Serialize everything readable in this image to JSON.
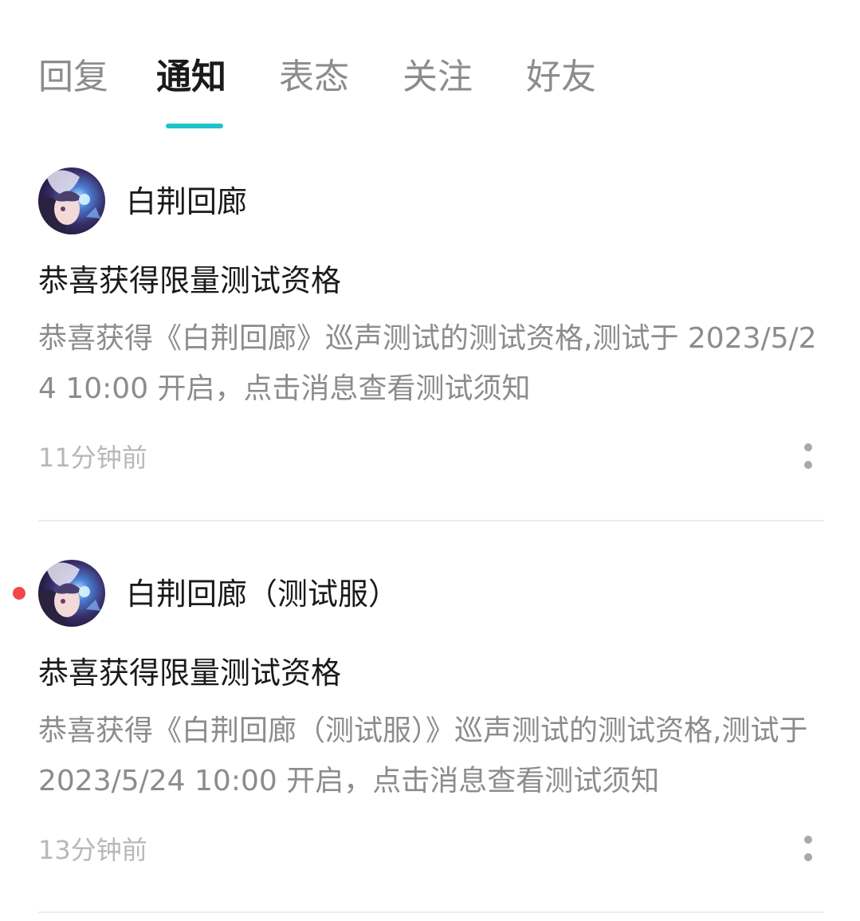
{
  "tabs": [
    {
      "label": "回复",
      "active": false
    },
    {
      "label": "通知",
      "active": true
    },
    {
      "label": "表态",
      "active": false
    },
    {
      "label": "关注",
      "active": false
    },
    {
      "label": "好友",
      "active": false
    }
  ],
  "accent_color": "#1ec3c8",
  "unread_color": "#f2484a",
  "notifications": [
    {
      "sender": "白荆回廊",
      "title": "恭喜获得限量测试资格",
      "body": "恭喜获得《白荆回廊》巡声测试的测试资格,测试于 2023/5/24 10:00 开启，点击消息查看测试须知",
      "time": "11分钟前",
      "unread": false
    },
    {
      "sender": "白荆回廊（测试服）",
      "title": "恭喜获得限量测试资格",
      "body": "恭喜获得《白荆回廊（测试服）》巡声测试的测试资格,测试于 2023/5/24 10:00 开启，点击消息查看测试须知",
      "time": "13分钟前",
      "unread": true
    }
  ]
}
